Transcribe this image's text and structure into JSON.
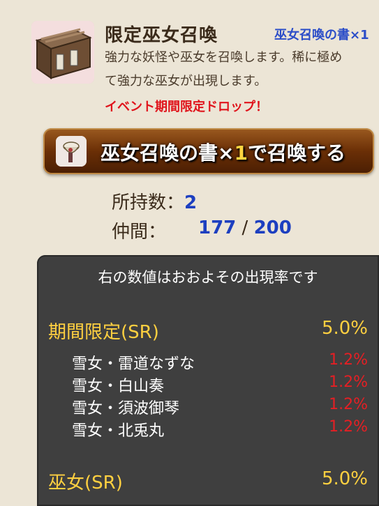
{
  "header": {
    "title": "限定巫女召喚",
    "title_sub": "巫女召喚の書×1",
    "desc_line1": "強力な妖怪や巫女を召喚します。稀に極め",
    "desc_line2": "て強力な巫女が出現します。",
    "event_text": "イベント期間限定ドロップ！",
    "icon": "scroll-box-icon"
  },
  "summon_button": {
    "icon": "scroll-summon-icon",
    "label_prefix": "巫女召喚の書×",
    "quantity": "1",
    "label_suffix": "で召喚する"
  },
  "stats": {
    "owned_label": "所持数：",
    "owned_value": "2",
    "party_label": "仲間：",
    "party_current": "177",
    "party_separator": "/",
    "party_max": "200"
  },
  "rates": {
    "title": "右の数値はおおよその出現率です",
    "groups": [
      {
        "label": "期間限定(SR)",
        "rate": "5.0%",
        "members": [
          {
            "name": "雪女・雷道なずな",
            "rate": "1.2%"
          },
          {
            "name": "雪女・白山奏",
            "rate": "1.2%"
          },
          {
            "name": "雪女・須波御琴",
            "rate": "1.2%"
          },
          {
            "name": "雪女・北兎丸",
            "rate": "1.2%"
          }
        ]
      },
      {
        "label": "巫女(SR)",
        "rate": "5.0%"
      }
    ]
  },
  "colors": {
    "page_bg": "#ece5d6",
    "accent_blue": "#1d3fc0",
    "event_red": "#e0141c",
    "rate_gold": "#ffd040",
    "rate_red": "#e51f24",
    "panel_bg": "#3f3f3f"
  }
}
